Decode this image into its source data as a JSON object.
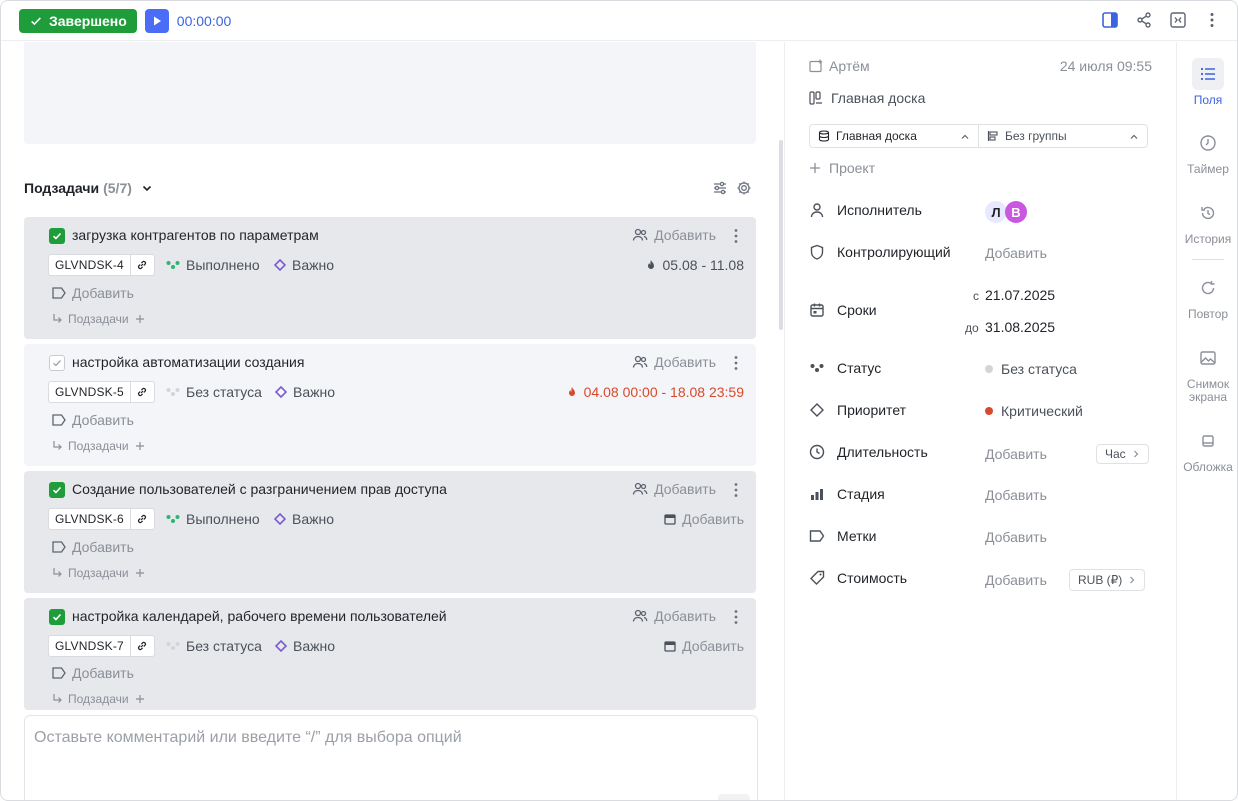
{
  "topbar": {
    "done_label": "Завершено",
    "timer": "00:00:00"
  },
  "subtasks": {
    "title": "Подзадачи",
    "count": "(5/7)",
    "items": [
      {
        "title": "загрузка контрагентов по параметрам",
        "done": true,
        "assignee_label": "Добавить",
        "code": "GLVNDSK-4",
        "status": "Выполнено",
        "priority": "Важно",
        "dates": "05.08 - 11.08",
        "dates_style": "normal",
        "tags_label": "Добавить",
        "subtasks_label": "Подзадачи"
      },
      {
        "title": "настройка автоматизации создания",
        "done": false,
        "assignee_label": "Добавить",
        "code": "GLVNDSK-5",
        "status": "Без статуса",
        "priority": "Важно",
        "dates": "04.08 00:00 - 18.08 23:59",
        "dates_style": "red",
        "tags_label": "Добавить",
        "subtasks_label": "Подзадачи"
      },
      {
        "title": "Создание пользователей с разграничением прав доступа",
        "done": true,
        "assignee_label": "Добавить",
        "code": "GLVNDSK-6",
        "status": "Выполнено",
        "priority": "Важно",
        "dates": "Добавить",
        "dates_style": "grey",
        "tags_label": "Добавить",
        "subtasks_label": "Подзадачи"
      },
      {
        "title": "настройка календарей, рабочего времени пользователей",
        "done": true,
        "assignee_label": "Добавить",
        "code": "GLVNDSK-7",
        "status": "Без статуса",
        "priority": "Важно",
        "dates": "Добавить",
        "dates_style": "grey",
        "tags_label": "Добавить",
        "subtasks_label": "Подзадачи"
      }
    ]
  },
  "comment": {
    "placeholder": "Оставьте комментарий или введите “/” для выбора опций"
  },
  "detail": {
    "creator": "Артём",
    "created_at": "24 июля 09:55",
    "board": "Главная доска",
    "board_select": "Главная доска",
    "group_select": "Без группы",
    "project_label": "Проект",
    "fields": {
      "assignee": {
        "label": "Исполнитель",
        "avatars": [
          "Л",
          "В"
        ]
      },
      "controller": {
        "label": "Контролирующий",
        "value": "Добавить"
      },
      "dates": {
        "label": "Сроки",
        "from_prefix": "с",
        "from": "21.07.2025",
        "to_prefix": "до",
        "to": "31.08.2025"
      },
      "status": {
        "label": "Статус",
        "value": "Без статуса",
        "color": "#d2d4d8"
      },
      "priority": {
        "label": "Приоритет",
        "value": "Критический",
        "color": "#d64a2d"
      },
      "duration": {
        "label": "Длительность",
        "value": "Добавить",
        "unit": "Час"
      },
      "stage": {
        "label": "Стадия",
        "value": "Добавить"
      },
      "tags": {
        "label": "Метки",
        "value": "Добавить"
      },
      "cost": {
        "label": "Стоимость",
        "value": "Добавить",
        "currency": "RUB (₽)"
      }
    }
  },
  "rnav": {
    "fields": "Поля",
    "timer": "Таймер",
    "history": "История",
    "repeat": "Повтор",
    "screenshot": "Снимок экрана",
    "cover": "Обложка"
  },
  "colors": {
    "accent": "#3b63e0",
    "done_green": "#1f9d3a",
    "status_green": "#2bb673",
    "priority_purple": "#7b5cd6",
    "danger": "#d64a2d"
  }
}
